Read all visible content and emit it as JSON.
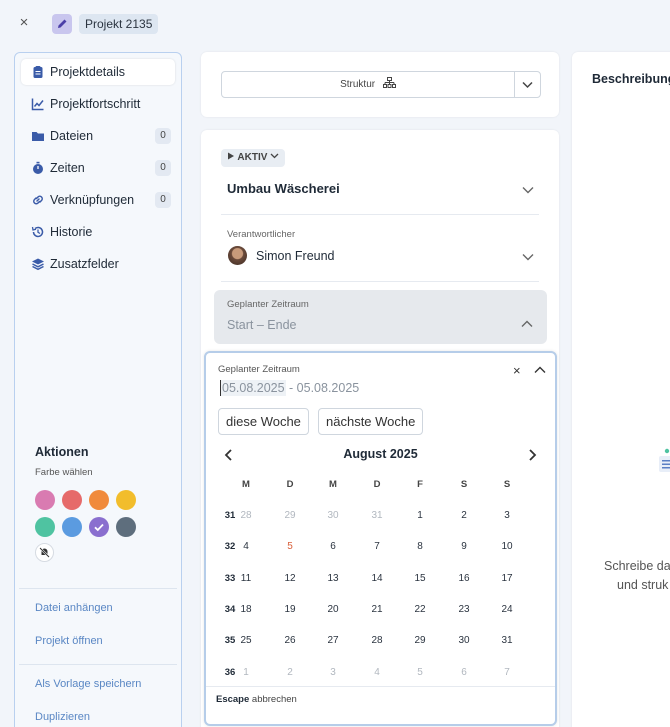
{
  "topbar": {
    "close": "×",
    "project_tag": "Projekt 2135"
  },
  "sidebar": {
    "items": [
      {
        "label": "Projektdetails",
        "icon": "clipboard-icon",
        "count": ""
      },
      {
        "label": "Projektfortschritt",
        "icon": "chart-line-icon",
        "count": ""
      },
      {
        "label": "Dateien",
        "icon": "folder-icon",
        "count": "0"
      },
      {
        "label": "Zeiten",
        "icon": "stopwatch-icon",
        "count": "0"
      },
      {
        "label": "Verknüpfungen",
        "icon": "link-icon",
        "count": "0"
      },
      {
        "label": "Historie",
        "icon": "history-icon",
        "count": ""
      },
      {
        "label": "Zusatzfelder",
        "icon": "layers-icon",
        "count": ""
      }
    ],
    "aktionen": "Aktionen",
    "farbe_label": "Farbe wählen",
    "colors": [
      "#d97bb1",
      "#e66a6a",
      "#f08a3c",
      "#f2bd2c",
      "#4fc3a1",
      "#5b9be0",
      "#8a6fcf",
      "#5e6e7d"
    ],
    "links": [
      "Datei anhängen",
      "Projekt öffnen",
      "Als Vorlage speichern",
      "Duplizieren"
    ]
  },
  "main": {
    "struktur_label": "Struktur",
    "status": "AKTIV",
    "project_title": "Umbau Wäscherei",
    "verantwortlicher_label": "Verantwortlicher",
    "verantwortlicher_value": "Simon Freund",
    "zeitraum_label": "Geplanter Zeitraum",
    "zeitraum_value": "Start – Ende"
  },
  "picker": {
    "label": "Geplanter Zeitraum",
    "close": "×",
    "start": "05.08.2025",
    "separator": " - ",
    "end": "05.08.2025",
    "quick": [
      "diese Woche",
      "nächste Woche"
    ],
    "month": "August 2025",
    "weekday_headers": [
      "M",
      "D",
      "M",
      "D",
      "F",
      "S",
      "S"
    ],
    "weeks": [
      {
        "week": "31",
        "days": [
          "28",
          "29",
          "30",
          "31",
          "1",
          "2",
          "3"
        ]
      },
      {
        "week": "32",
        "days": [
          "4",
          "5",
          "6",
          "7",
          "8",
          "9",
          "10"
        ]
      },
      {
        "week": "33",
        "days": [
          "11",
          "12",
          "13",
          "14",
          "15",
          "16",
          "17"
        ]
      },
      {
        "week": "34",
        "days": [
          "18",
          "19",
          "20",
          "21",
          "22",
          "23",
          "24"
        ]
      },
      {
        "week": "35",
        "days": [
          "25",
          "26",
          "27",
          "28",
          "29",
          "30",
          "31"
        ]
      },
      {
        "week": "36",
        "days": [
          "1",
          "2",
          "3",
          "4",
          "5",
          "6",
          "7"
        ]
      }
    ],
    "footer_key": "Escape",
    "footer_text": " abbrechen"
  },
  "right": {
    "title": "Beschreibung",
    "text1": "Schreibe da",
    "text2": "und struk"
  }
}
